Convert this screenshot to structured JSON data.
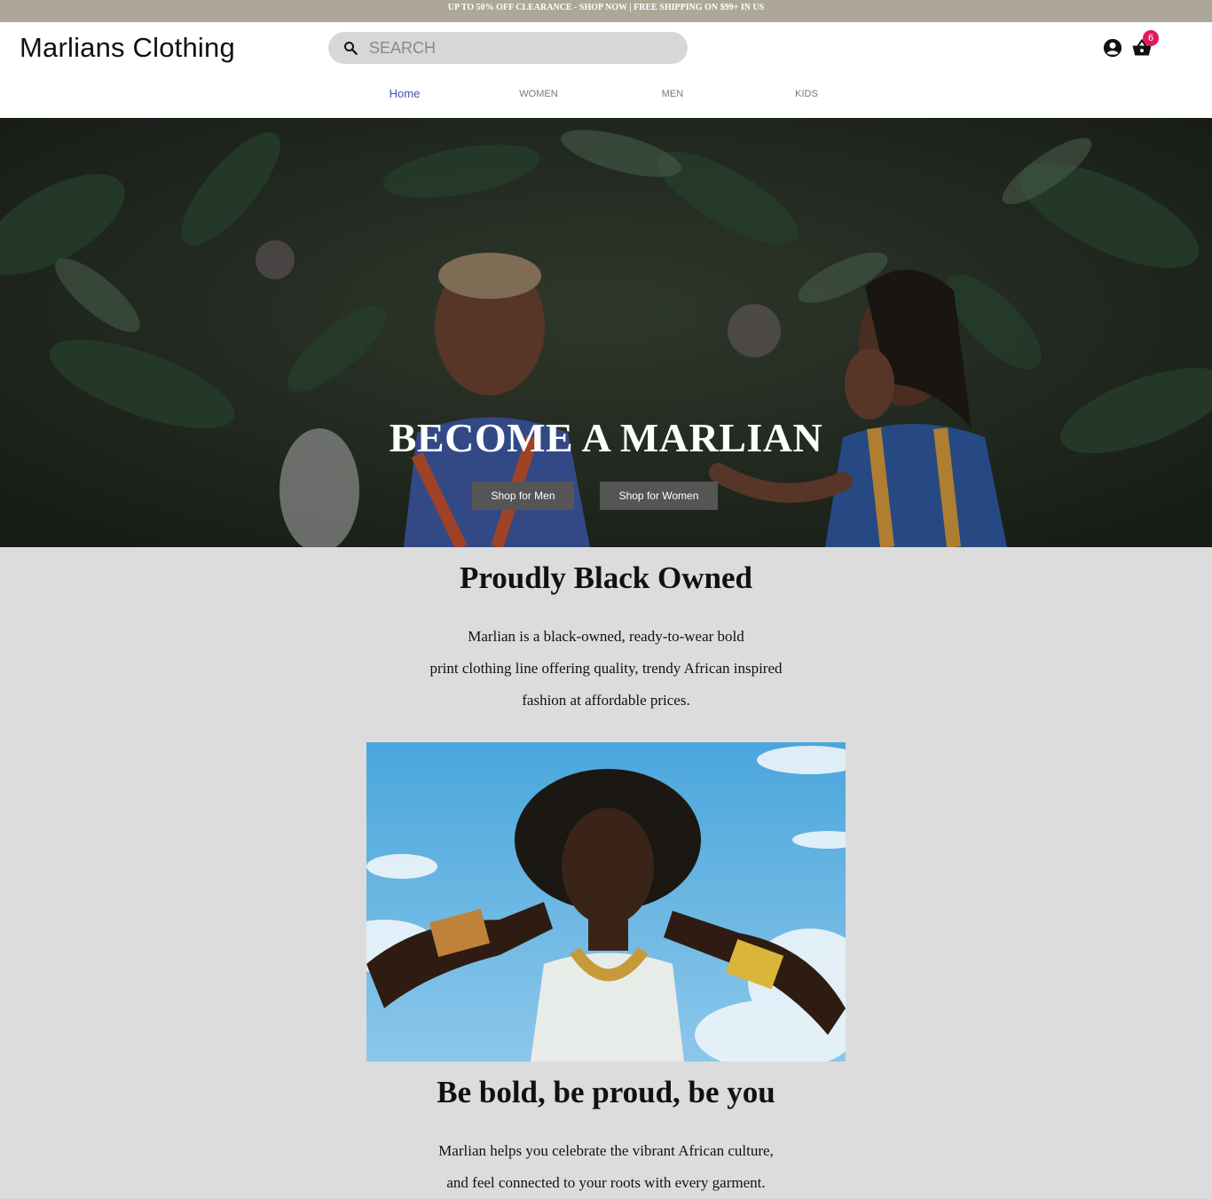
{
  "promo": {
    "text": "UP TO 50% OFF CLEARANCE - SHOP NOW | FREE SHIPPING ON $99+ IN US"
  },
  "header": {
    "brand": "Marlians Clothing",
    "search_placeholder": "SEARCH",
    "cart_count": "6",
    "icons": [
      "search-icon",
      "account-icon",
      "shopping-basket-icon"
    ]
  },
  "nav": {
    "items": [
      {
        "label": "Home",
        "active": true
      },
      {
        "label": "WOMEN",
        "active": false
      },
      {
        "label": "MEN",
        "active": false
      },
      {
        "label": "KIDS",
        "active": false
      }
    ]
  },
  "hero": {
    "title": "BECOME A MARLIAN",
    "buttons": {
      "men": "Shop for Men",
      "women": "Shop for Women"
    }
  },
  "about": {
    "title": "Proudly Black Owned",
    "lines": [
      "Marlian is a black-owned, ready-to-wear bold",
      "print clothing line offering quality, trendy African inspired",
      "fashion at affordable prices."
    ]
  },
  "bold": {
    "title": "Be bold, be proud, be you",
    "lines": [
      "Marlian helps you celebrate the vibrant African culture,",
      "and feel connected to your roots with every garment."
    ]
  },
  "colors": {
    "promo_bg": "#aca797",
    "nav_active": "#3f51b5",
    "badge": "#e3185e",
    "page_bg": "#dcdcdc",
    "button_bg": "#555555"
  }
}
